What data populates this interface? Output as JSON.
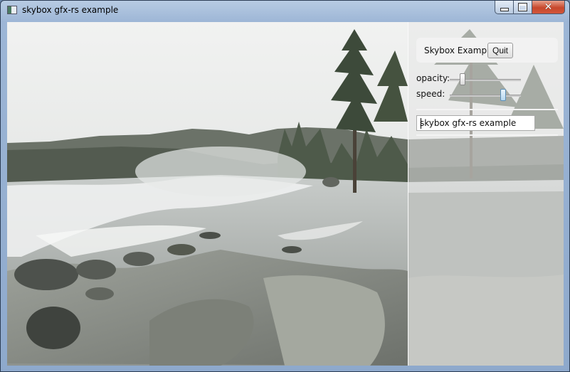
{
  "window": {
    "title": "skybox gfx-rs example",
    "icon": "app-window-icon",
    "controls": [
      "minimize-icon",
      "maximize-icon",
      "close-icon"
    ]
  },
  "panel": {
    "title": "Skybox Example",
    "quit_label": "Quit",
    "sliders": [
      {
        "label": "opacity:",
        "value": 0.18,
        "active": false
      },
      {
        "label": "speed:",
        "value": 0.75,
        "active": true
      }
    ],
    "text_input": {
      "value": "skybox gfx-rs example"
    }
  },
  "colors": {
    "title_bar": "#9db6d6",
    "close_button": "#c7472c",
    "panel_bg": "#e8e8e8",
    "slider_active": "#b6d7f0"
  }
}
